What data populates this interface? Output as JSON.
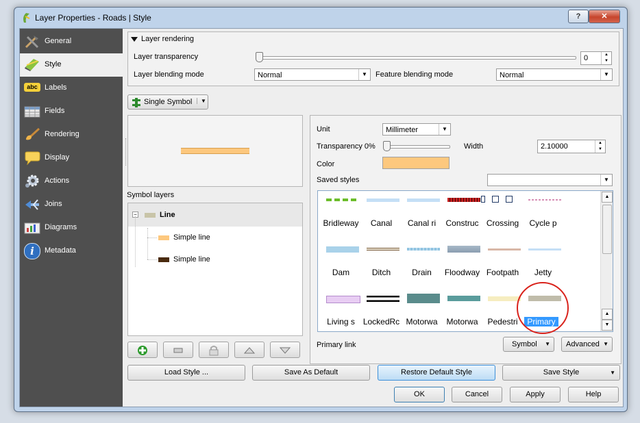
{
  "window": {
    "title": "Layer Properties - Roads | Style",
    "help_label": "?",
    "close_label": "✕"
  },
  "sidebar": {
    "items": [
      {
        "label": "General",
        "icon": "tools-icon"
      },
      {
        "label": "Style",
        "icon": "brush-icon"
      },
      {
        "label": "Labels",
        "icon": "abc-icon"
      },
      {
        "label": "Fields",
        "icon": "table-icon"
      },
      {
        "label": "Rendering",
        "icon": "paintbrush-icon"
      },
      {
        "label": "Display",
        "icon": "speech-bubble-icon"
      },
      {
        "label": "Actions",
        "icon": "gear-icon"
      },
      {
        "label": "Joins",
        "icon": "joins-icon"
      },
      {
        "label": "Diagrams",
        "icon": "diagram-icon"
      },
      {
        "label": "Metadata",
        "icon": "info-icon"
      }
    ],
    "active_index": 1,
    "abc_text": "abc",
    "info_text": "i"
  },
  "layer_rendering": {
    "header": "Layer rendering",
    "transparency_label": "Layer transparency",
    "transparency_value": "0",
    "transparency_level": 0,
    "blending_label": "Layer blending mode",
    "blending_value": "Normal",
    "feature_blending_label": "Feature blending mode",
    "feature_blending_value": "Normal"
  },
  "renderer": {
    "type": "Single Symbol"
  },
  "symbol_layers": {
    "header": "Symbol layers",
    "root": "Line",
    "children": [
      "Simple line",
      "Simple line"
    ],
    "colors": {
      "root": "#c8c4a8",
      "child1": "#fdc87e",
      "child2": "#4a2b0f"
    }
  },
  "symbol_props": {
    "unit_label": "Unit",
    "unit_value": "Millimeter",
    "transparency_label": "Transparency 0%",
    "transparency_level": 0,
    "width_label": "Width",
    "width_value": "2.10000",
    "color_label": "Color",
    "color_value": "#fdc87e",
    "saved_styles_label": "Saved styles",
    "saved_styles_value": ""
  },
  "styles_grid": [
    [
      "Bridleway",
      "Canal",
      "Canal ri",
      "Construc",
      "Crossing",
      "Cycle p"
    ],
    [
      "Dam",
      "Ditch",
      "Drain",
      "Floodway",
      "Footpath",
      "Jetty"
    ],
    [
      "Living s",
      "LockedRc",
      "Motorwa",
      "Motorwa",
      "Pedestri",
      "Primary"
    ]
  ],
  "selected_style": "Primary",
  "current_style_name": "Primary link",
  "symbol_button": "Symbol",
  "advanced_button": "Advanced",
  "bottom_buttons": {
    "load": "Load Style ...",
    "save_default": "Save As Default",
    "restore_default": "Restore Default Style",
    "save_style": "Save Style"
  },
  "dialog_buttons": {
    "ok": "OK",
    "cancel": "Cancel",
    "apply": "Apply",
    "help": "Help"
  },
  "colors": {
    "sidebar_bg": "#4f4f4f",
    "selection": "#3399ff",
    "annotation": "#d9221b"
  }
}
